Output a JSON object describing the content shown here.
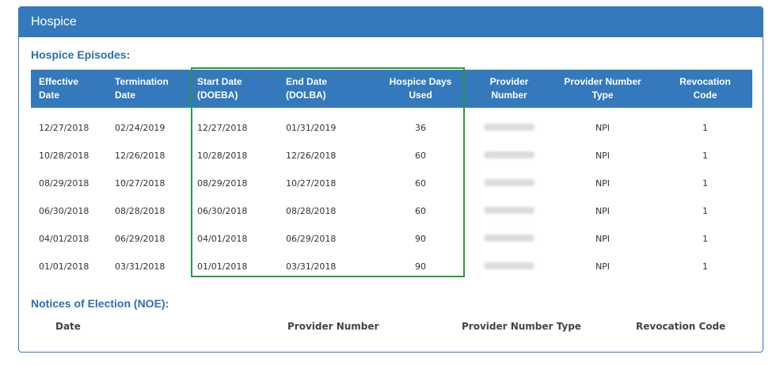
{
  "panel": {
    "title": "Hospice"
  },
  "episodes": {
    "title": "Hospice Episodes:",
    "headers": {
      "effective_1": "Effective",
      "effective_2": "Date",
      "termination_1": "Termination",
      "termination_2": "Date",
      "start_1": "Start Date",
      "start_2": "(DOEBA)",
      "end_1": "End Date",
      "end_2": "(DOLBA)",
      "days_1": "Hospice Days",
      "days_2": "Used",
      "provider_1": "Provider",
      "provider_2": "Number",
      "ptype_1": "Provider Number",
      "ptype_2": "Type",
      "revocation_1": "Revocation",
      "revocation_2": "Code"
    },
    "rows": [
      {
        "effective": "12/27/2018",
        "termination": "02/24/2019",
        "start": "12/27/2018",
        "end": "01/31/2019",
        "days": "36",
        "ptype": "NPI",
        "revocation": "1"
      },
      {
        "effective": "10/28/2018",
        "termination": "12/26/2018",
        "start": "10/28/2018",
        "end": "12/26/2018",
        "days": "60",
        "ptype": "NPI",
        "revocation": "1"
      },
      {
        "effective": "08/29/2018",
        "termination": "10/27/2018",
        "start": "08/29/2018",
        "end": "10/27/2018",
        "days": "60",
        "ptype": "NPI",
        "revocation": "1"
      },
      {
        "effective": "06/30/2018",
        "termination": "08/28/2018",
        "start": "06/30/2018",
        "end": "08/28/2018",
        "days": "60",
        "ptype": "NPI",
        "revocation": "1"
      },
      {
        "effective": "04/01/2018",
        "termination": "06/29/2018",
        "start": "04/01/2018",
        "end": "06/29/2018",
        "days": "90",
        "ptype": "NPI",
        "revocation": "1"
      },
      {
        "effective": "01/01/2018",
        "termination": "03/31/2018",
        "start": "01/01/2018",
        "end": "03/31/2018",
        "days": "90",
        "ptype": "NPI",
        "revocation": "1"
      }
    ]
  },
  "noe": {
    "title": "Notices of Election (NOE):",
    "headers": {
      "date": "Date",
      "provider_number": "Provider Number",
      "provider_number_type": "Provider Number Type",
      "revocation_code": "Revocation Code"
    }
  },
  "colors": {
    "header_blue": "#3479bc",
    "title_blue": "#2a6fb2",
    "highlight_green": "#2a9a3a"
  }
}
